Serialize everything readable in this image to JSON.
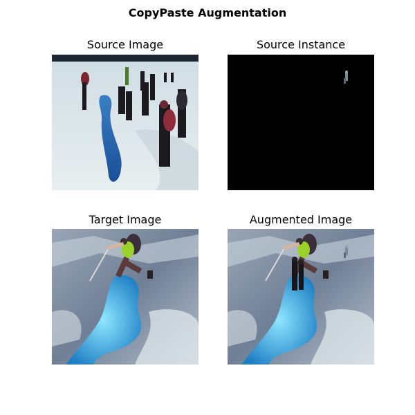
{
  "figure": {
    "title": "CopyPaste Augmentation"
  },
  "panels": [
    {
      "title": "Source Image"
    },
    {
      "title": "Source Instance"
    },
    {
      "title": "Target Image"
    },
    {
      "title": "Augmented Image"
    }
  ],
  "colors": {
    "snow": "#dfe7ea",
    "crevasse_blue": "#1f5fa8",
    "ice_blue": "#4cc3ea",
    "ice_gray": "#7f8da0",
    "background_black": "#000000"
  }
}
